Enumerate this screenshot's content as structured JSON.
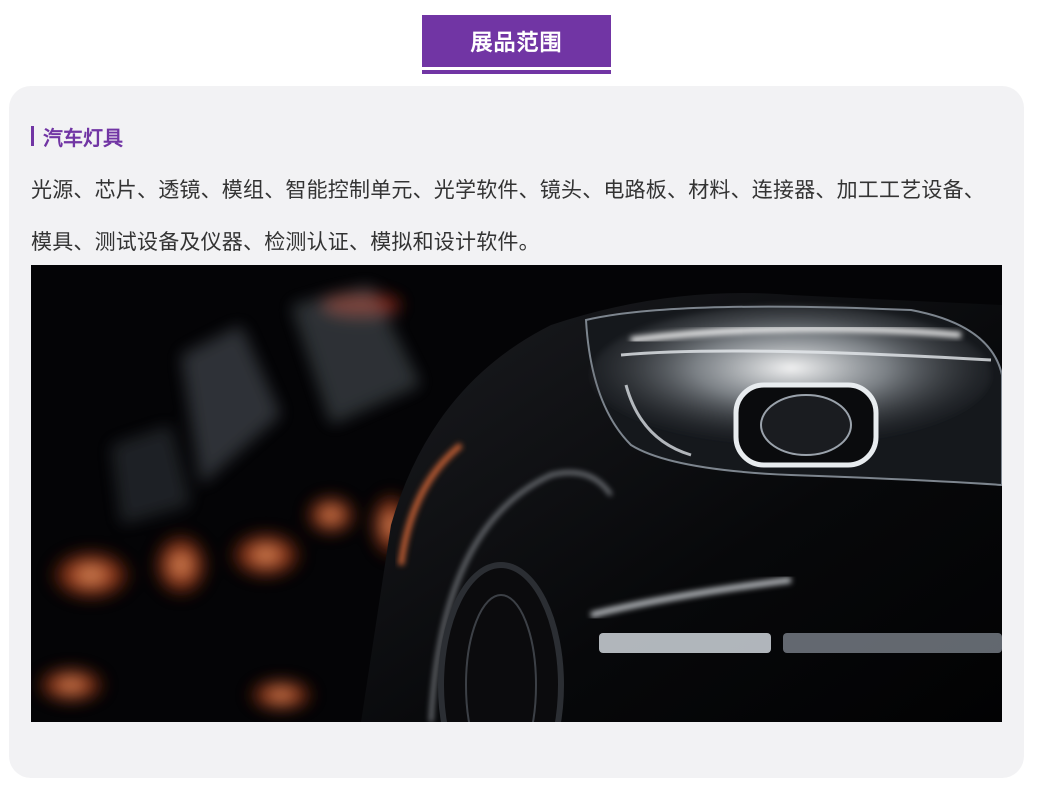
{
  "header": {
    "title": "展品范围"
  },
  "section": {
    "heading": "汽车灯具",
    "description": "光源、芯片、透镜、模组、智能控制单元、光学软件、镜头、电路板、材料、连接器、加工工艺设备、模具、测试设备及仪器、检测认证、模拟和设计软件。"
  },
  "image": {
    "subject": "car-headlight-photo"
  },
  "colors": {
    "accent": "#7135a4",
    "card_bg": "#f2f2f4",
    "text": "#333333"
  }
}
